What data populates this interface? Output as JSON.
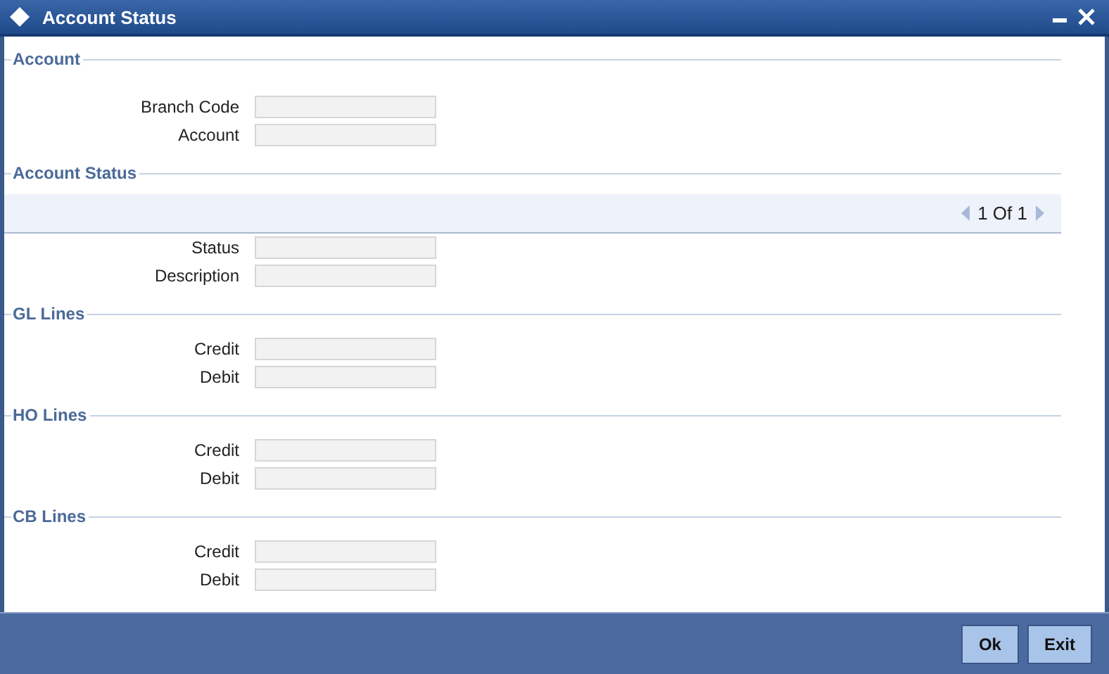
{
  "window": {
    "title": "Account Status"
  },
  "sections": [
    {
      "title": "Account",
      "fields": [
        {
          "label": "Branch Code"
        },
        {
          "label": "Account"
        }
      ]
    },
    {
      "title": "Account Status",
      "pager": {
        "text": "1 Of 1"
      },
      "fields": [
        {
          "label": "Status"
        },
        {
          "label": "Description"
        }
      ]
    },
    {
      "title": "GL Lines",
      "fields": [
        {
          "label": "Credit"
        },
        {
          "label": "Debit"
        }
      ]
    },
    {
      "title": "HO Lines",
      "fields": [
        {
          "label": "Credit"
        },
        {
          "label": "Debit"
        }
      ]
    },
    {
      "title": "CB Lines",
      "fields": [
        {
          "label": "Credit"
        },
        {
          "label": "Debit"
        }
      ]
    }
  ],
  "buttons": [
    "Ok",
    "Exit"
  ]
}
